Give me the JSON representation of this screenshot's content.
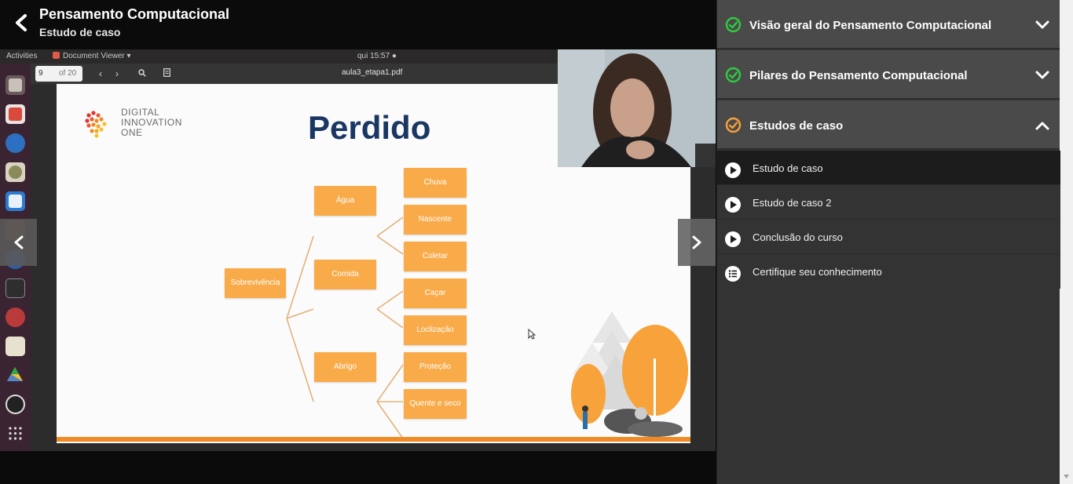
{
  "header": {
    "course_title": "Pensamento Computacional",
    "lesson_subtitle": "Estudo de caso"
  },
  "video": {
    "ubuntu_bar": {
      "activities": "Activities",
      "app_name": "Document Viewer ▾",
      "clock": "qui 15:57 ●"
    },
    "viewer": {
      "page_number": "9",
      "page_total": "of 20",
      "filename": "aula3_etapa1.pdf"
    },
    "slide": {
      "logo_line1": "DIGITAL",
      "logo_line2": "INNOVATION",
      "logo_line3": "ONE",
      "title": "Perdido",
      "root": "Sobrevivência",
      "level1": [
        "Água",
        "Comida",
        "Abrigo"
      ],
      "agua_children": [
        "Chuva",
        "Nascente"
      ],
      "comida_children": [
        "Coletar",
        "Caçar"
      ],
      "abrigo_children": [
        "Loclização",
        "Proteção",
        "Quente  e seco"
      ],
      "accent_color": "#f9ab4a",
      "title_color": "#1a3763"
    }
  },
  "sidebar": {
    "sections": [
      {
        "title": "Visão geral do Pensamento Computacional",
        "status": "complete",
        "expanded": false
      },
      {
        "title": "Pilares do Pensamento Computacional",
        "status": "complete",
        "expanded": false
      },
      {
        "title": "Estudos de caso",
        "status": "in-progress",
        "expanded": true
      }
    ],
    "lessons": [
      {
        "label": "Estudo de caso",
        "type": "video",
        "active": true
      },
      {
        "label": "Estudo de caso 2",
        "type": "video",
        "active": false
      },
      {
        "label": "Conclusão do curso",
        "type": "video",
        "active": false
      },
      {
        "label": "Certifique seu conhecimento",
        "type": "quiz",
        "active": false
      }
    ],
    "colors": {
      "complete": "#2ecc40",
      "in_progress": "#f7a23a"
    }
  }
}
